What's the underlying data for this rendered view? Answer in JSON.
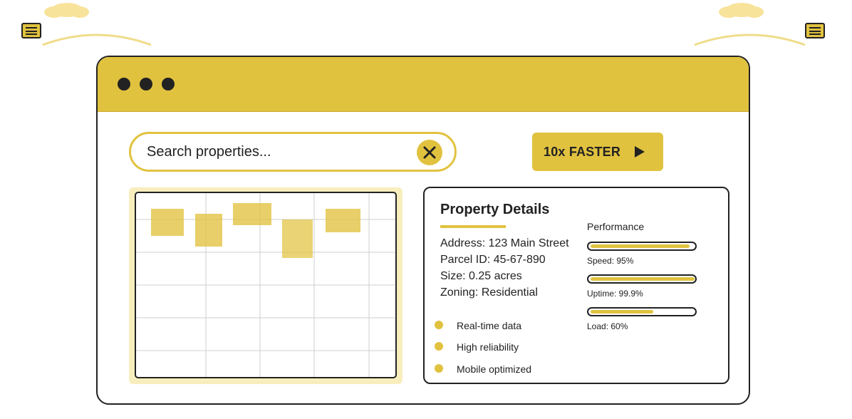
{
  "colors": {
    "accent": "#e1c23f",
    "accent_light": "#f8eebd",
    "outline": "#222222",
    "background": "#ffffff"
  },
  "decor": {
    "left_menu_icon": "menu-icon",
    "right_menu_icon": "menu-icon"
  },
  "window": {
    "dots": [
      "window-dot",
      "window-dot",
      "window-dot"
    ]
  },
  "search": {
    "placeholder": "Search properties...",
    "clear_icon": "close-icon"
  },
  "cta": {
    "label": "10x FASTER",
    "icon": "play-icon"
  },
  "map": {
    "grid_columns": 5,
    "grid_rows": 6,
    "parcels": 5
  },
  "property": {
    "title": "Property Details",
    "address": "Address: 123 Main Street",
    "parcel_id": "Parcel ID: 45-67-890",
    "size": "Size: 0.25 acres",
    "zoning": "Zoning: Residential",
    "features": [
      {
        "label": "Real-time data"
      },
      {
        "label": "High reliability"
      },
      {
        "label": "Mobile optimized"
      }
    ]
  },
  "performance": {
    "title": "Performance",
    "metrics": [
      {
        "label": "Speed: 95%",
        "value": 0.95
      },
      {
        "label": "Uptime: 99.9%",
        "value": 0.999
      },
      {
        "label": "Load: 60%",
        "value": 0.6
      }
    ]
  }
}
